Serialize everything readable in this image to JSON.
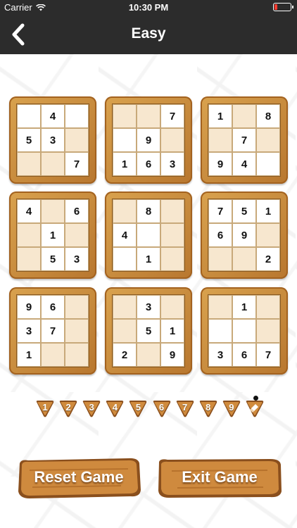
{
  "status_bar": {
    "carrier": "Carrier",
    "time": "10:30 PM",
    "battery_level": 0.2
  },
  "nav": {
    "title": "Easy",
    "back_icon": "chevron-left-icon"
  },
  "colors": {
    "nav_bg": "#2c2c2c",
    "wood": "#c8873a",
    "tan_cell": "#f7e7cf"
  },
  "boxes": [
    {
      "cells": [
        "",
        "4",
        "",
        "5",
        "3",
        "",
        "",
        "",
        "7"
      ],
      "tan": [
        0,
        0,
        0,
        0,
        0,
        1,
        1,
        1,
        0
      ]
    },
    {
      "cells": [
        "",
        "",
        "7",
        "",
        "9",
        "",
        "1",
        "6",
        "3"
      ],
      "tan": [
        1,
        1,
        0,
        0,
        0,
        1,
        0,
        0,
        0
      ]
    },
    {
      "cells": [
        "1",
        "",
        "8",
        "",
        "7",
        "",
        "9",
        "4",
        ""
      ],
      "tan": [
        0,
        1,
        0,
        1,
        0,
        1,
        0,
        0,
        0
      ]
    },
    {
      "cells": [
        "4",
        "",
        "6",
        "",
        "1",
        "",
        "",
        "5",
        "3"
      ],
      "tan": [
        0,
        1,
        0,
        1,
        0,
        1,
        1,
        0,
        0
      ]
    },
    {
      "cells": [
        "",
        "8",
        "",
        "4",
        "",
        "",
        "",
        "1",
        ""
      ],
      "tan": [
        1,
        0,
        1,
        0,
        0,
        1,
        0,
        0,
        1
      ]
    },
    {
      "cells": [
        "7",
        "5",
        "1",
        "6",
        "9",
        "",
        "",
        "",
        "2"
      ],
      "tan": [
        0,
        0,
        0,
        0,
        0,
        1,
        1,
        1,
        0
      ]
    },
    {
      "cells": [
        "9",
        "6",
        "",
        "3",
        "7",
        "",
        "1",
        "",
        ""
      ],
      "tan": [
        0,
        0,
        1,
        0,
        0,
        1,
        0,
        1,
        1
      ]
    },
    {
      "cells": [
        "",
        "3",
        "",
        "",
        "5",
        "1",
        "2",
        "",
        "9"
      ],
      "tan": [
        1,
        0,
        1,
        1,
        0,
        0,
        0,
        1,
        0
      ]
    },
    {
      "cells": [
        "",
        "1",
        "",
        "",
        "",
        "",
        "3",
        "6",
        "7"
      ],
      "tan": [
        1,
        0,
        1,
        0,
        0,
        1,
        0,
        0,
        0
      ]
    }
  ],
  "numpad": [
    "1",
    "2",
    "3",
    "4",
    "5",
    "6",
    "7",
    "8",
    "9"
  ],
  "eraser_icon": "eraser-icon",
  "buttons": {
    "reset": "Reset Game",
    "exit": "Exit Game"
  }
}
